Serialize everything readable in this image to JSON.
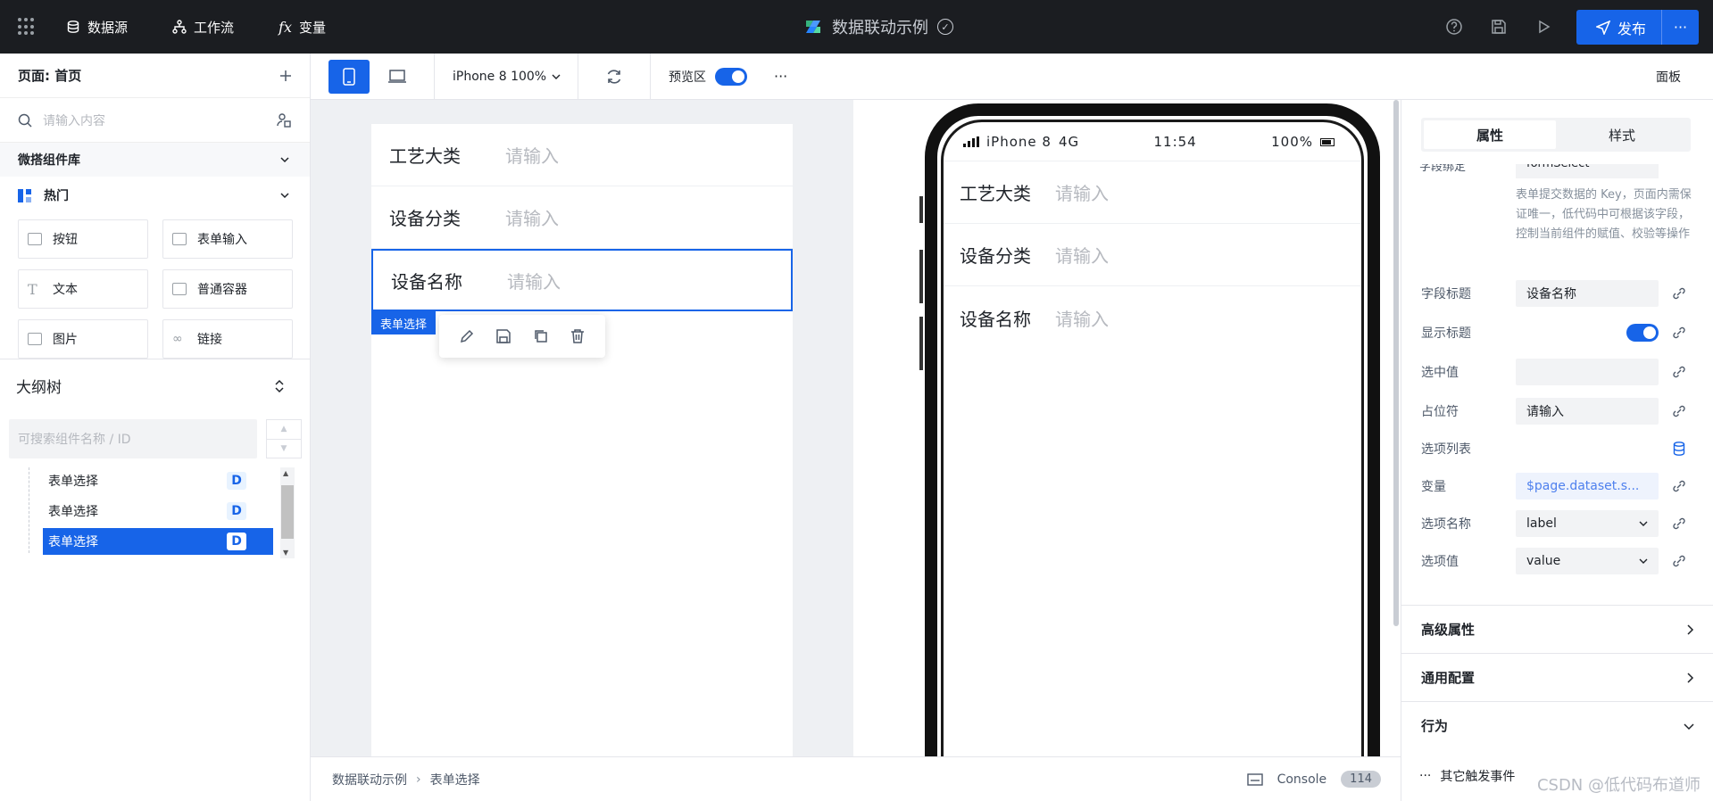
{
  "topbar": {
    "nav": [
      {
        "label": "数据源",
        "icon": "database-icon"
      },
      {
        "label": "工作流",
        "icon": "workflow-icon"
      },
      {
        "label": "变量",
        "icon": "fx-icon"
      }
    ],
    "app_title": "数据联动示例",
    "publish_label": "发布",
    "publish_more": "···",
    "fx_glyph": "fx"
  },
  "left": {
    "page_label": "页面: 首页",
    "search_placeholder": "请输入内容",
    "library_title": "微搭组件库",
    "hot_title": "热门",
    "components": [
      {
        "label": "按钮",
        "icon": "button-icon"
      },
      {
        "label": "表单输入",
        "icon": "form-input-icon"
      },
      {
        "label": "文本",
        "icon": "text-icon"
      },
      {
        "label": "普通容器",
        "icon": "container-icon"
      },
      {
        "label": "图片",
        "icon": "image-icon"
      },
      {
        "label": "链接",
        "icon": "link-icon"
      }
    ],
    "outline_title": "大纲树",
    "outline_search_placeholder": "可搜索组件名称 / ID",
    "tree": [
      {
        "label": "表单选择",
        "badge": "D",
        "selected": false
      },
      {
        "label": "表单选择",
        "badge": "D",
        "selected": false
      },
      {
        "label": "表单选择",
        "badge": "D",
        "selected": true
      }
    ]
  },
  "toolbar": {
    "device_label": "iPhone 8 100%",
    "preview_label": "预览区",
    "more": "···",
    "panel_label": "面板"
  },
  "editor": {
    "rows": [
      {
        "label": "工艺大类",
        "placeholder": "请输入"
      },
      {
        "label": "设备分类",
        "placeholder": "请输入"
      },
      {
        "label": "设备名称",
        "placeholder": "请输入"
      }
    ],
    "selected_tag": "表单选择"
  },
  "phone": {
    "carrier": "iPhone 8",
    "network": "4G",
    "time": "11:54",
    "battery": "100%",
    "rows": [
      {
        "label": "工艺大类",
        "placeholder": "请输入"
      },
      {
        "label": "设备分类",
        "placeholder": "请输入"
      },
      {
        "label": "设备名称",
        "placeholder": "请输入"
      }
    ]
  },
  "bottom": {
    "crumbs": [
      "数据联动示例",
      "表单选择"
    ],
    "console_label": "Console",
    "console_count": "114"
  },
  "right": {
    "tabs": [
      "属性",
      "样式"
    ],
    "cut_label": "字段绑定",
    "cut_value": "formSelect",
    "field_desc": "表单提交数据的 Key，页面内需保证唯一，低代码中可根据该字段，控制当前组件的赋值、校验等操作",
    "props": {
      "field_title_label": "字段标题",
      "field_title_value": "设备名称",
      "show_title_label": "显示标题",
      "selected_value_label": "选中值",
      "selected_value": "",
      "placeholder_label": "占位符",
      "placeholder_value": "请输入",
      "options_label": "选项列表",
      "variable_label": "变量",
      "variable_value": "$page.dataset.s...",
      "option_name_label": "选项名称",
      "option_name_value": "label",
      "option_value_label": "选项值",
      "option_value_value": "value"
    },
    "sections": [
      "高级属性",
      "通用配置",
      "行为"
    ],
    "events_label": "其它触发事件",
    "events_dots": "···"
  },
  "watermark": "CSDN @低代码布道师"
}
